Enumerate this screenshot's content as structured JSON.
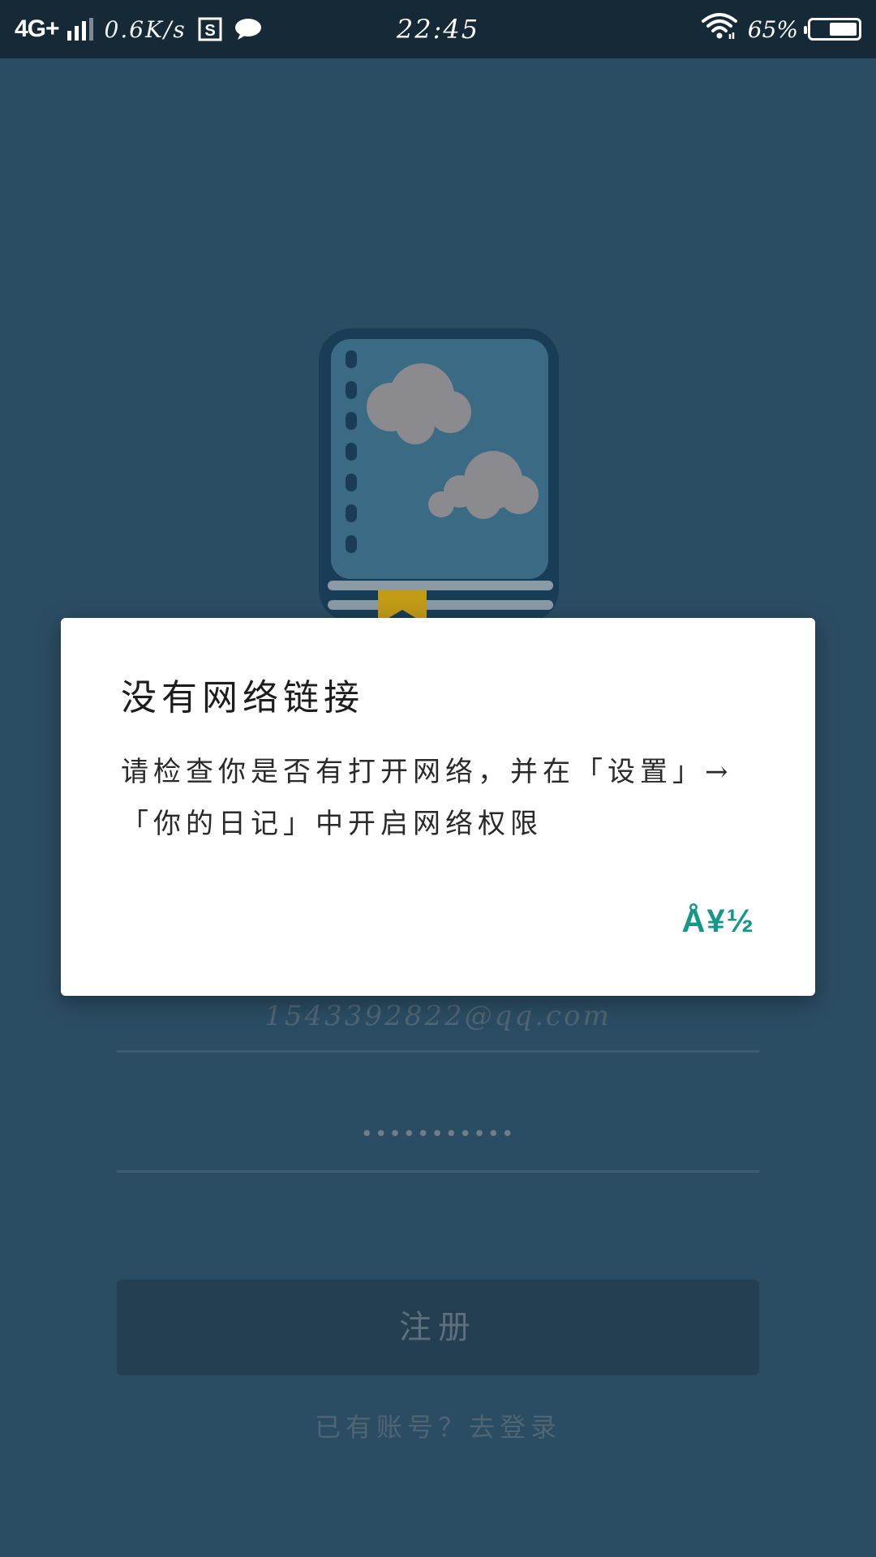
{
  "status_bar": {
    "network_type": "4G+",
    "net_speed": "0.6K/s",
    "time": "22:45",
    "battery_percent": "65%",
    "battery_level": 0.65,
    "icons": [
      "signal-icon",
      "s-app-icon",
      "chat-icon",
      "wifi-icon",
      "battery-icon"
    ]
  },
  "form": {
    "email_value": "1543392822@qq.com",
    "password_value": "•••••••••••",
    "register_label": "注册",
    "login_link": "已有账号？去登录"
  },
  "dialog": {
    "title": "没有网络链接",
    "message": "请检查你是否有打开网络，并在「设置」→「你的日记」中开启网络权限",
    "confirm_label": "Å¥½"
  },
  "colors": {
    "background": "#2b4d63",
    "status_bar": "#152937",
    "accent": "#17978a",
    "logo_outline": "#1a3d57",
    "logo_page": "#3b6a84",
    "bookmark": "#c29b17"
  }
}
